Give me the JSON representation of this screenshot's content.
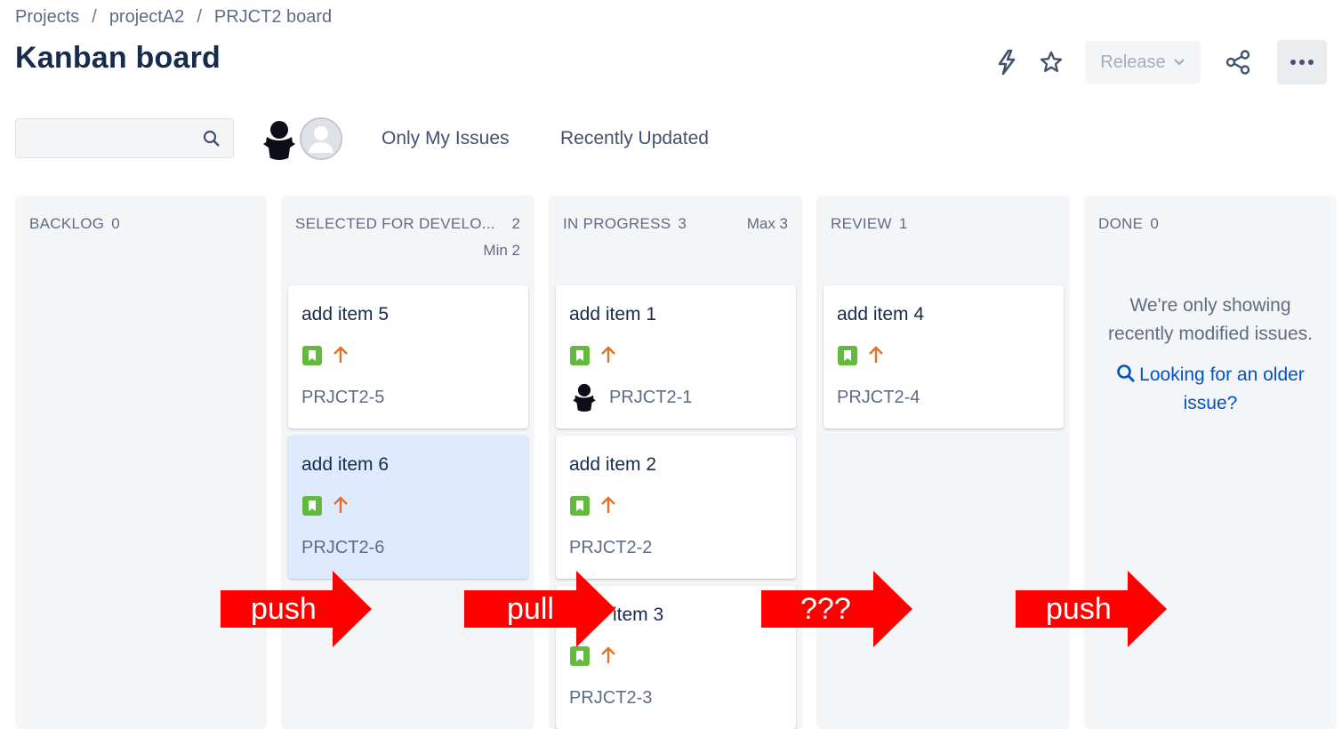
{
  "breadcrumbs": [
    "Projects",
    "projectA2",
    "PRJCT2 board"
  ],
  "breadcrumb_separator": "/",
  "title": "Kanban board",
  "actions": {
    "release_label": "Release",
    "icons": [
      "lightning-icon",
      "star-icon",
      "share-icon",
      "more-icon"
    ]
  },
  "filters": {
    "search_placeholder": "",
    "only_my_issues": "Only My Issues",
    "recently_updated": "Recently Updated"
  },
  "columns": [
    {
      "name": "BACKLOG",
      "count": "0"
    },
    {
      "name": "SELECTED FOR DEVELO...",
      "count": "2",
      "constraint": "Min 2"
    },
    {
      "name": "IN PROGRESS",
      "count": "3",
      "constraint": "Max 3"
    },
    {
      "name": "REVIEW",
      "count": "1"
    },
    {
      "name": "DONE",
      "count": "0"
    }
  ],
  "cards": {
    "selected": [
      {
        "title": "add item 5",
        "key": "PRJCT2-5"
      },
      {
        "title": "add item 6",
        "key": "PRJCT2-6"
      }
    ],
    "in_progress": [
      {
        "title": "add item 1",
        "key": "PRJCT2-1"
      },
      {
        "title": "add item 2",
        "key": "PRJCT2-2"
      },
      {
        "title": "item 3",
        "key": "PRJCT2-3"
      }
    ],
    "review": [
      {
        "title": "add item 4",
        "key": "PRJCT2-4"
      }
    ]
  },
  "done_message": {
    "line1": "We're only showing",
    "line2": "recently modified issues.",
    "link1": "Looking for an older",
    "link2": "issue?"
  },
  "overlay_arrows": [
    "push",
    "pull",
    "???",
    "push"
  ],
  "colors": {
    "story": "#63ba3c",
    "priority": "#e2722b",
    "arrow": "#ff0000",
    "link": "#0052cc",
    "selected_card": "#deebff"
  }
}
